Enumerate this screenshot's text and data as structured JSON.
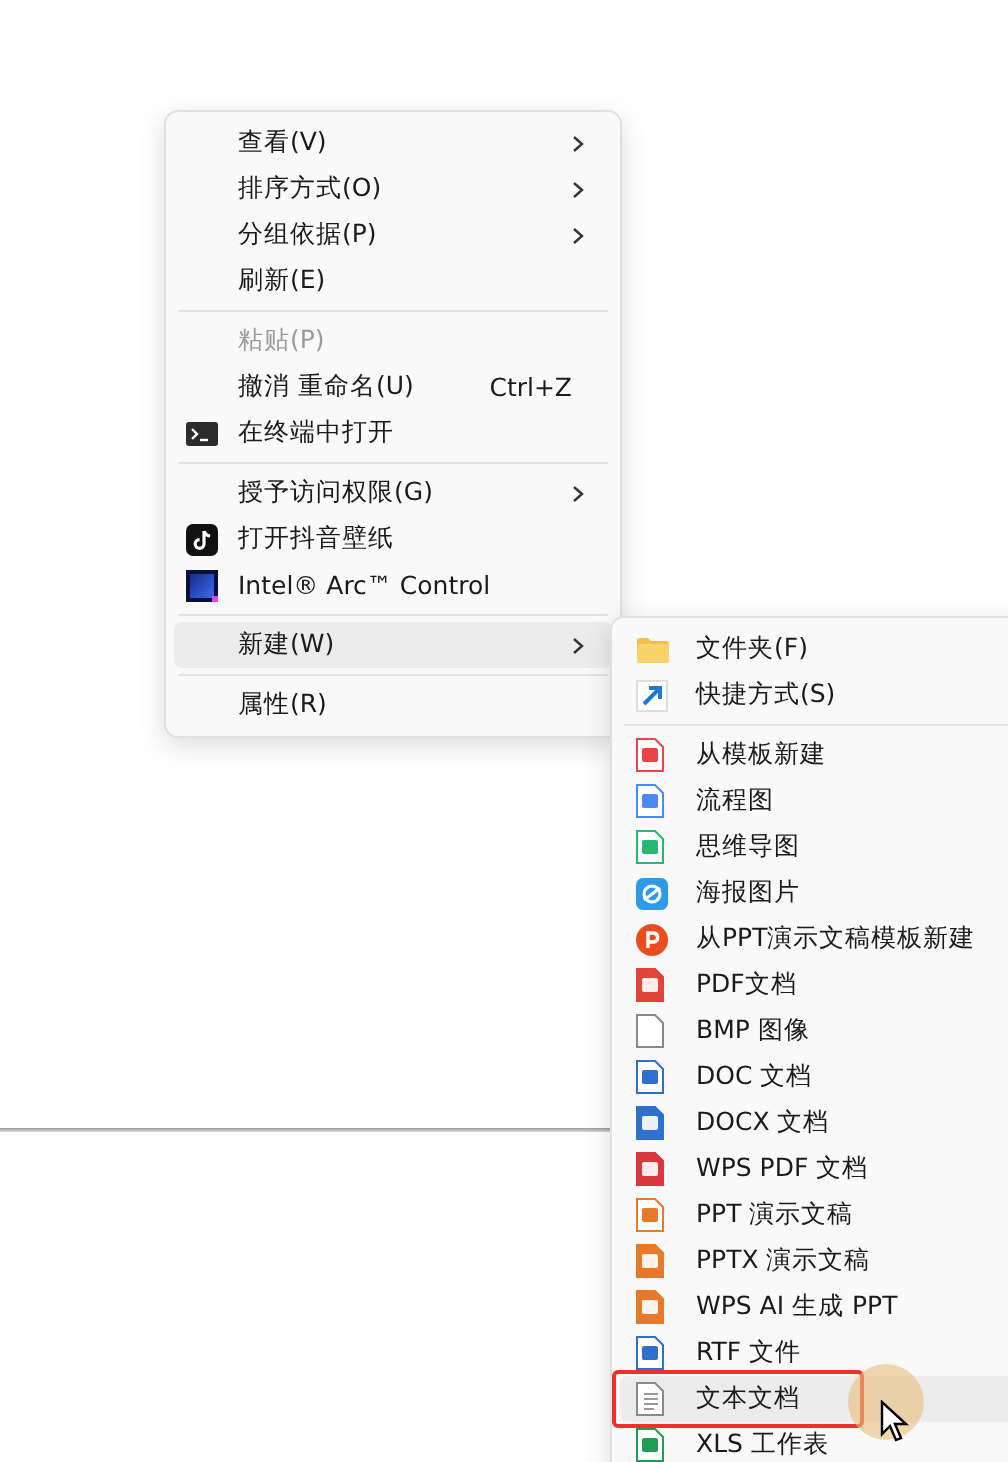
{
  "context_menu": {
    "items": [
      {
        "kind": "plain",
        "label": "查看(V)",
        "submenu": true,
        "disabled": false,
        "selected": false
      },
      {
        "kind": "plain",
        "label": "排序方式(O)",
        "submenu": true,
        "disabled": false,
        "selected": false
      },
      {
        "kind": "plain",
        "label": "分组依据(P)",
        "submenu": true,
        "disabled": false,
        "selected": false
      },
      {
        "kind": "plain",
        "label": "刷新(E)",
        "submenu": false,
        "disabled": false,
        "selected": false
      },
      {
        "kind": "separator"
      },
      {
        "kind": "plain",
        "label": "粘贴(P)",
        "submenu": false,
        "disabled": true,
        "selected": false
      },
      {
        "kind": "plain",
        "label": "撤消 重命名(U)",
        "shortcut": "Ctrl+Z",
        "submenu": false,
        "disabled": false,
        "selected": false
      },
      {
        "kind": "terminal",
        "label": "在终端中打开",
        "submenu": false,
        "disabled": false,
        "selected": false
      },
      {
        "kind": "separator"
      },
      {
        "kind": "plain",
        "label": "授予访问权限(G)",
        "submenu": true,
        "disabled": false,
        "selected": false
      },
      {
        "kind": "tiktok",
        "label": "打开抖音壁纸",
        "submenu": false,
        "disabled": false,
        "selected": false
      },
      {
        "kind": "intel",
        "label": "Intel® Arc™ Control",
        "submenu": false,
        "disabled": false,
        "selected": false
      },
      {
        "kind": "separator"
      },
      {
        "kind": "plain",
        "label": "新建(W)",
        "submenu": true,
        "disabled": false,
        "selected": true
      },
      {
        "kind": "separator"
      },
      {
        "kind": "plain",
        "label": "属性(R)",
        "submenu": false,
        "disabled": false,
        "selected": false
      }
    ]
  },
  "new_submenu": {
    "items": [
      {
        "kind": "folder",
        "label": "文件夹(F)",
        "selected": false,
        "marked": false
      },
      {
        "kind": "shortcut",
        "label": "快捷方式(S)",
        "selected": false,
        "marked": false
      },
      {
        "kind": "separator"
      },
      {
        "kind": "template",
        "label": "从模板新建",
        "selected": false,
        "marked": false
      },
      {
        "kind": "flowchart",
        "label": "流程图",
        "selected": false,
        "marked": false
      },
      {
        "kind": "mindmap",
        "label": "思维导图",
        "selected": false,
        "marked": false
      },
      {
        "kind": "poster",
        "label": "海报图片",
        "selected": false,
        "marked": false
      },
      {
        "kind": "pptbadge",
        "label": "从PPT演示文稿模板新建",
        "selected": false,
        "marked": false
      },
      {
        "kind": "pdf",
        "label": "PDF文档",
        "selected": false,
        "marked": false
      },
      {
        "kind": "blank",
        "label": "BMP 图像",
        "selected": false,
        "marked": false
      },
      {
        "kind": "doc",
        "label": "DOC 文档",
        "selected": false,
        "marked": false
      },
      {
        "kind": "docx",
        "label": "DOCX 文档",
        "selected": false,
        "marked": false
      },
      {
        "kind": "wpspdf",
        "label": "WPS PDF 文档",
        "selected": false,
        "marked": false
      },
      {
        "kind": "ppt",
        "label": "PPT 演示文稿",
        "selected": false,
        "marked": false
      },
      {
        "kind": "pptx",
        "label": "PPTX 演示文稿",
        "selected": false,
        "marked": false
      },
      {
        "kind": "pptx",
        "label": "WPS AI 生成 PPT",
        "selected": false,
        "marked": false
      },
      {
        "kind": "doc",
        "label": "RTF 文件",
        "selected": false,
        "marked": false
      },
      {
        "kind": "text",
        "label": "文本文档",
        "selected": true,
        "marked": true
      },
      {
        "kind": "xls",
        "label": "XLS 工作表",
        "selected": false,
        "marked": false
      }
    ]
  }
}
